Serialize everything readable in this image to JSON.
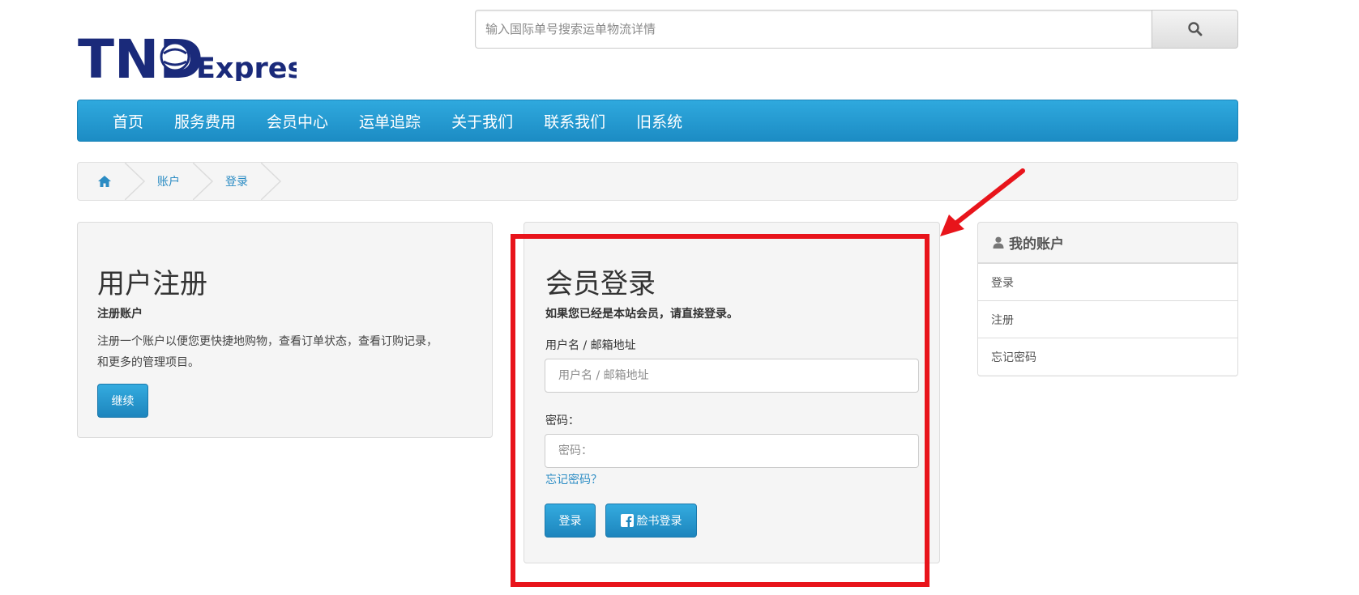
{
  "brand": {
    "logo_letters": "TND",
    "logo_text": "Express"
  },
  "search": {
    "placeholder": "输入国际单号搜索运单物流详情",
    "icon": "search-icon"
  },
  "nav": {
    "items": [
      "首页",
      "服务费用",
      "会员中心",
      "运单追踪",
      "关于我们",
      "联系我们",
      "旧系统"
    ]
  },
  "breadcrumb": {
    "home_icon": "home-icon",
    "items": [
      "账户",
      "登录"
    ]
  },
  "register": {
    "title": "用户注册",
    "subtitle": "注册账户",
    "line1": "注册一个账户以便您更快捷地购物，查看订单状态，查看订购记录，",
    "line2": "和更多的管理项目。",
    "button": "继续"
  },
  "login": {
    "title": "会员登录",
    "subtitle": "如果您已经是本站会员，请直接登录。",
    "username_label": "用户名 / 邮箱地址",
    "username_placeholder": "用户名 / 邮箱地址",
    "password_label": "密码：",
    "password_placeholder": "密码：",
    "forgot_link": "忘记密码？",
    "login_button": "登录",
    "facebook_button": "脸书登录"
  },
  "account": {
    "title": "我的账户",
    "items": [
      "登录",
      "注册",
      "忘记密码"
    ]
  },
  "colors": {
    "nav_blue": "#1f93cc",
    "link_blue": "#2b8cc4",
    "highlight_red": "#e8141b"
  }
}
